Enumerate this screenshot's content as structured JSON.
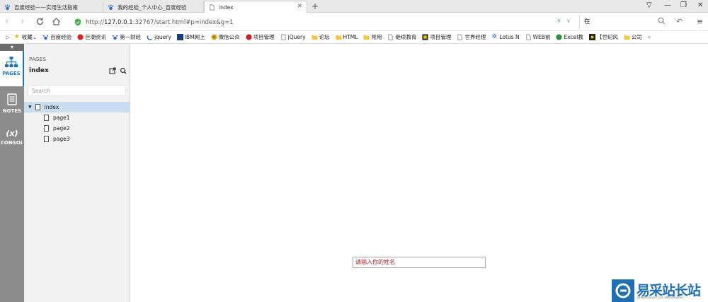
{
  "tabs": [
    {
      "label": "百度经验——实用生活指南"
    },
    {
      "label": "我的经验_个人中心_百度经验"
    },
    {
      "label": "index"
    }
  ],
  "address": {
    "prefix": "http://",
    "host": "127.0.0.1",
    "rest": ":32767/start.html#p=index&g=1"
  },
  "search_value": "在",
  "bookmarks": [
    "收藏",
    "百度经验",
    "巨潮资讯",
    "第一财经",
    "jquery",
    "IBM网上",
    "微信公众",
    "项目管理",
    "jQuery",
    "论坛",
    "HTML",
    "常用",
    "继续教育",
    "项目管理",
    "世界经理",
    "Lotus N",
    "WEB前",
    "Excel教",
    "【世纪风",
    "公司"
  ],
  "rail": {
    "pages": "PAGES",
    "notes": "NOTES",
    "console": "CONSOL",
    "console_symbol": "(x)"
  },
  "panel": {
    "heading": "PAGES",
    "title": "index",
    "search_placeholder": "Search",
    "tree": [
      {
        "label": "index"
      },
      {
        "label": "page1"
      },
      {
        "label": "page2"
      },
      {
        "label": "page3"
      }
    ]
  },
  "name_input_value": "请输入你的姓名",
  "watermark": {
    "text": "易采站长站",
    "sub": "Www.Easck.Com Webmaster"
  },
  "colors": {
    "accent": "#1b75bb",
    "rail": "#8c8c8c",
    "selected_row": "#c9dff1",
    "input_text": "#b11b1b"
  }
}
